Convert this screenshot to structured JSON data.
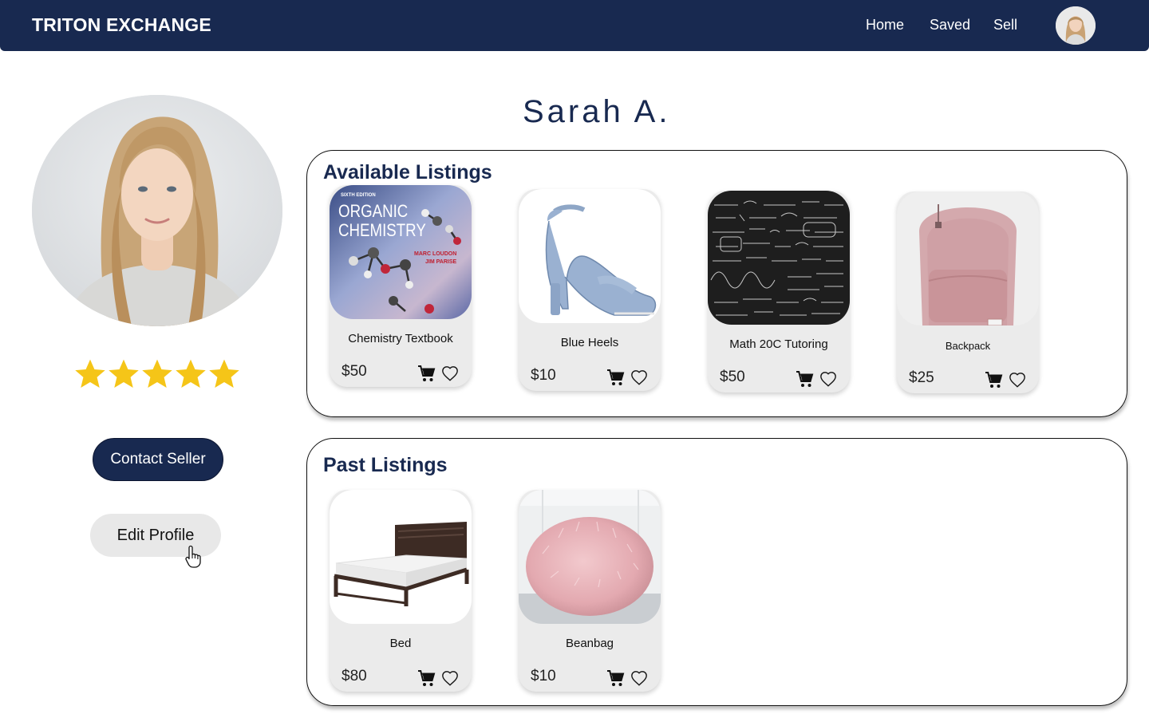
{
  "navbar": {
    "brand": "TRITON EXCHANGE",
    "links": [
      "Home",
      "Saved",
      "Sell"
    ]
  },
  "profile": {
    "name": "Sarah A.",
    "rating_stars": 5,
    "rating_max": 5,
    "contact_label": "Contact Seller",
    "edit_label": "Edit Profile"
  },
  "available": {
    "title": "Available Listings",
    "items": [
      {
        "name": "Chemistry Textbook",
        "price": "$50",
        "image": "organic-chemistry-book",
        "cover_edition": "SIXTH EDITION",
        "cover_title_1": "ORGANIC",
        "cover_title_2": "CHEMISTRY",
        "cover_author_1": "MARC LOUDON",
        "cover_author_2": "JIM PARISE"
      },
      {
        "name": "Blue Heels",
        "price": "$10",
        "image": "blue-heel-sandal"
      },
      {
        "name": "Math 20C Tutoring",
        "price": "$50",
        "image": "chalkboard-equations"
      },
      {
        "name": "Backpack",
        "price": "$25",
        "image": "pink-backpack"
      }
    ]
  },
  "past": {
    "title": "Past Listings",
    "items": [
      {
        "name": "Bed",
        "price": "$80",
        "image": "wooden-bed"
      },
      {
        "name": "Beanbag",
        "price": "$10",
        "image": "pink-fur-beanbag"
      }
    ]
  },
  "colors": {
    "navy": "#182950",
    "star": "#f5c518",
    "card_bg": "#ebebeb",
    "edit_button_bg": "#e8e8e8"
  },
  "icons": {
    "cart": "shopping-cart-icon",
    "heart": "heart-outline-icon",
    "star": "star-icon",
    "pointer": "hand-pointer-icon"
  }
}
